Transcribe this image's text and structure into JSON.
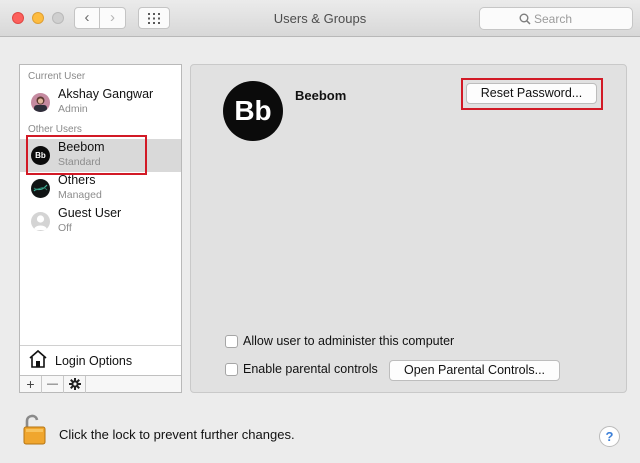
{
  "window": {
    "title": "Users & Groups"
  },
  "toolbar": {
    "back_icon": "chevron-left-icon",
    "forward_icon": "chevron-right-icon",
    "grid_icon": "grid-icon",
    "search_placeholder": "Search"
  },
  "sidebar": {
    "current_user_header": "Current User",
    "other_users_header": "Other Users",
    "current_user": {
      "name": "Akshay Gangwar",
      "role": "Admin"
    },
    "other_users": [
      {
        "name": "Beebom",
        "role": "Standard",
        "avatar_text": "Bb"
      },
      {
        "name": "Others",
        "role": "Managed"
      },
      {
        "name": "Guest User",
        "role": "Off"
      }
    ],
    "login_options_label": "Login Options",
    "add_label": "+",
    "remove_label": "—",
    "settings_icon": "gear-icon"
  },
  "detail": {
    "avatar_text": "Bb",
    "user_name": "Beebom",
    "reset_password_label": "Reset Password...",
    "admin_checkbox_label": "Allow user to administer this computer",
    "parental_checkbox_label": "Enable parental controls",
    "open_parental_label": "Open Parental Controls..."
  },
  "footer": {
    "lock_text": "Click the lock to prevent further changes.",
    "help_label": "?"
  },
  "colors": {
    "highlight": "#d21a26",
    "selection": "#d9d9d9"
  }
}
